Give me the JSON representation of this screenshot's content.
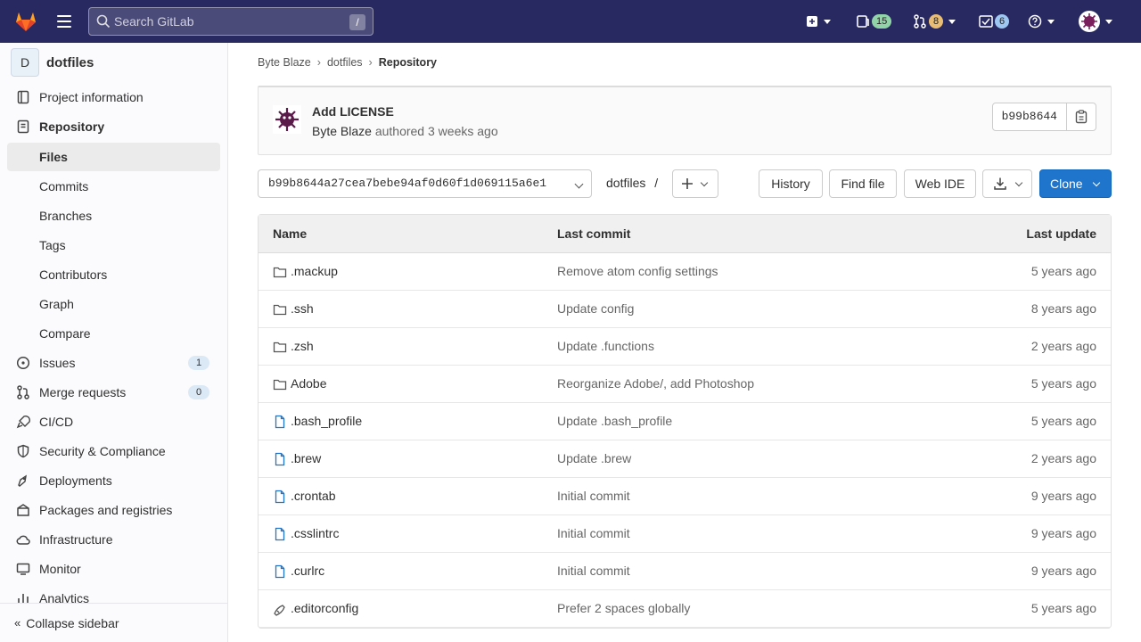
{
  "topbar": {
    "search_placeholder": "Search GitLab",
    "search_shortcut": "/",
    "issues_count": "15",
    "mr_count": "8",
    "todos_count": "6"
  },
  "colors": {
    "topbar_bg": "#292961",
    "primary": "#1f75cb",
    "badge_green": "#91d4a8",
    "badge_orange": "#e9be74",
    "badge_blue": "#9dc7f1"
  },
  "sidebar": {
    "project_initial": "D",
    "project_name": "dotfiles",
    "items": [
      {
        "label": "Project information",
        "icon": "info-icon"
      },
      {
        "label": "Repository",
        "icon": "doc-icon"
      },
      {
        "label": "Files"
      },
      {
        "label": "Commits"
      },
      {
        "label": "Branches"
      },
      {
        "label": "Tags"
      },
      {
        "label": "Contributors"
      },
      {
        "label": "Graph"
      },
      {
        "label": "Compare"
      },
      {
        "label": "Issues",
        "icon": "issues-icon",
        "count": "1"
      },
      {
        "label": "Merge requests",
        "icon": "merge-request-icon",
        "count": "0"
      },
      {
        "label": "CI/CD",
        "icon": "rocket-icon"
      },
      {
        "label": "Security & Compliance",
        "icon": "shield-icon"
      },
      {
        "label": "Deployments",
        "icon": "deployments-icon"
      },
      {
        "label": "Packages and registries",
        "icon": "package-icon"
      },
      {
        "label": "Infrastructure",
        "icon": "cloud-icon"
      },
      {
        "label": "Monitor",
        "icon": "monitor-icon"
      },
      {
        "label": "Analytics",
        "icon": "chart-icon"
      }
    ],
    "collapse_label": "Collapse sidebar"
  },
  "breadcrumb": {
    "items": [
      "Byte Blaze",
      "dotfiles",
      "Repository"
    ]
  },
  "last_commit": {
    "title": "Add LICENSE",
    "author": "Byte Blaze",
    "action": "authored",
    "time": "3 weeks ago",
    "sha": "b99b8644"
  },
  "toolbar": {
    "ref": "b99b8644a27cea7bebe94af0d60f1d069115a6e1",
    "path_root": "dotfiles",
    "path_sep": "/",
    "history": "History",
    "find_file": "Find file",
    "web_ide": "Web IDE",
    "clone": "Clone"
  },
  "table": {
    "headers": {
      "name": "Name",
      "last_commit": "Last commit",
      "last_update": "Last update"
    },
    "rows": [
      {
        "name": ".mackup",
        "type": "folder",
        "msg": "Remove atom config settings",
        "date": "5 years ago"
      },
      {
        "name": ".ssh",
        "type": "folder",
        "msg": "Update config",
        "date": "8 years ago"
      },
      {
        "name": ".zsh",
        "type": "folder",
        "msg": "Update .functions",
        "date": "2 years ago"
      },
      {
        "name": "Adobe",
        "type": "folder",
        "msg": "Reorganize Adobe/, add Photoshop",
        "date": "5 years ago"
      },
      {
        "name": ".bash_profile",
        "type": "file",
        "msg": "Update .bash_profile",
        "date": "5 years ago"
      },
      {
        "name": ".brew",
        "type": "file",
        "msg": "Update .brew",
        "date": "2 years ago"
      },
      {
        "name": ".crontab",
        "type": "file",
        "msg": "Initial commit",
        "date": "9 years ago"
      },
      {
        "name": ".csslintrc",
        "type": "file",
        "msg": "Initial commit",
        "date": "9 years ago"
      },
      {
        "name": ".curlrc",
        "type": "file",
        "msg": "Initial commit",
        "date": "9 years ago"
      },
      {
        "name": ".editorconfig",
        "type": "editorconfig",
        "msg": "Prefer 2 spaces globally",
        "date": "5 years ago"
      }
    ]
  }
}
